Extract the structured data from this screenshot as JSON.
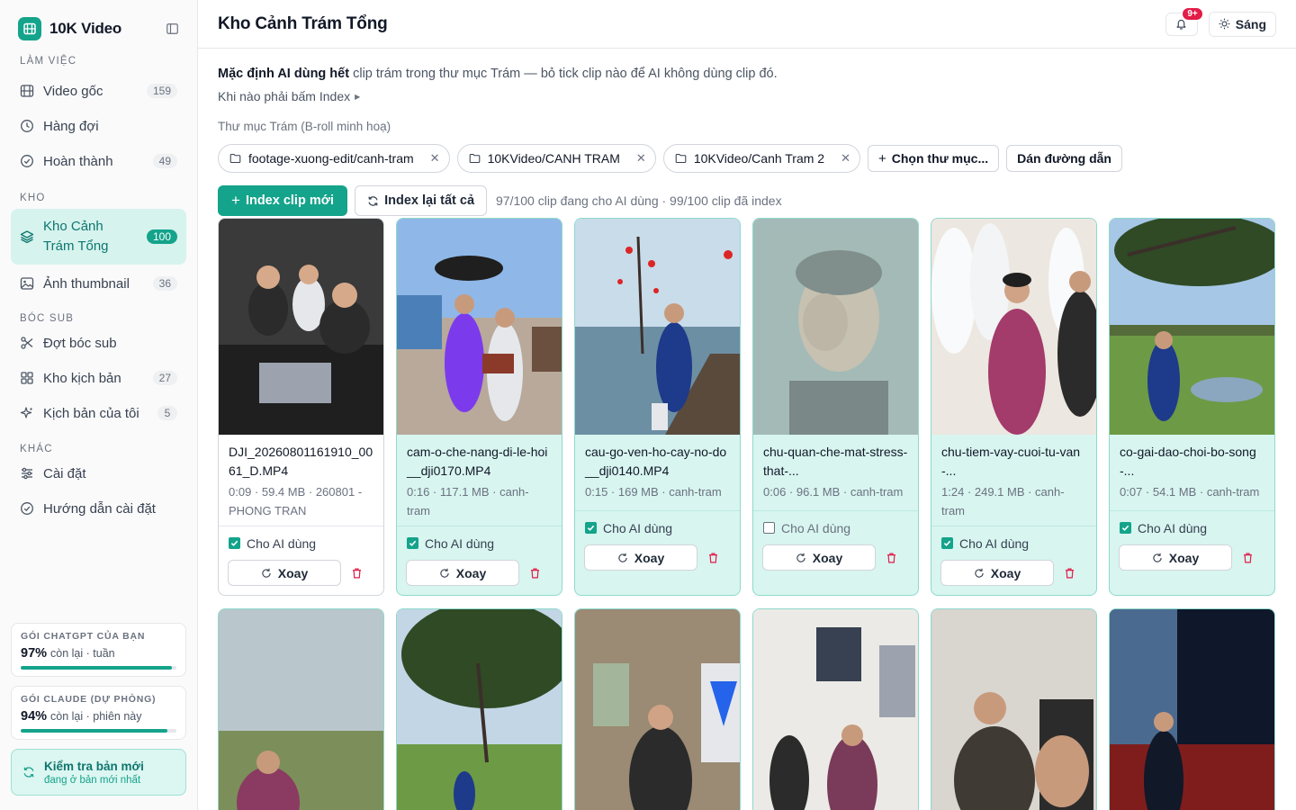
{
  "brand": {
    "name": "10K Video"
  },
  "sidebar": {
    "sections": [
      {
        "label": "LÀM VIỆC"
      },
      {
        "label": "KHO"
      },
      {
        "label": "BÓC SUB"
      },
      {
        "label": "KHÁC"
      }
    ],
    "items": [
      {
        "label": "Video gốc",
        "count": "159",
        "icon": "film-icon"
      },
      {
        "label": "Hàng đợi",
        "count": "",
        "icon": "clock-icon"
      },
      {
        "label": "Hoàn thành",
        "count": "49",
        "icon": "check-circle-icon"
      },
      {
        "label": "Kho Cảnh Trám Tổng",
        "count": "100",
        "icon": "layers-icon",
        "active": true
      },
      {
        "label": "Ảnh thumbnail",
        "count": "36",
        "icon": "image-icon"
      },
      {
        "label": "Đợt bóc sub",
        "count": "",
        "icon": "scissors-icon"
      },
      {
        "label": "Kho kịch bản",
        "count": "27",
        "icon": "grid-icon"
      },
      {
        "label": "Kịch bản của tôi",
        "count": "5",
        "icon": "sparkle-icon"
      },
      {
        "label": "Cài đặt",
        "count": "",
        "icon": "sliders-icon"
      },
      {
        "label": "Hướng dẫn cài đặt",
        "count": "",
        "icon": "check-circle-icon"
      }
    ],
    "plans": [
      {
        "title": "GÓI CHATGPT CỦA BẠN",
        "pct": "97%",
        "note": "còn lại · tuần",
        "fill": 0.97
      },
      {
        "title": "GÓI CLAUDE (DỰ PHÒNG)",
        "pct": "94%",
        "note": "còn lại · phiên này",
        "fill": 0.94
      }
    ],
    "update": {
      "title": "Kiểm tra bản mới",
      "sub": "đang ở bản mới nhất"
    }
  },
  "header": {
    "title": "Kho Cảnh Trám Tổng",
    "notif_badge": "9+",
    "theme_label": "Sáng"
  },
  "main": {
    "info_bold": "Mặc định AI dùng hết",
    "info_rest": " clip trám trong thư mục Trám — bỏ tick clip nào để AI không dùng clip đó.",
    "index_toggle": "Khi nào phải bấm Index",
    "folder_label": "Thư mục Trám (B-roll minh hoạ)",
    "folders": [
      "footage-xuong-edit/canh-tram",
      "10KVideo/CANH TRAM",
      "10KVideo/Canh Tram 2"
    ],
    "choose_folder": "Chọn thư mục...",
    "paste_path": "Dán đường dẫn",
    "index_new": "Index clip mới",
    "reindex_all": "Index lại tất cả",
    "stats": "97/100 clip đang cho AI dùng · 99/100 clip đã index",
    "check_label": "Cho AI dùng",
    "rotate_label": "Xoay"
  },
  "clips": [
    {
      "name": "DJI_20260801161910_0061_D.MP4",
      "meta": "0:09 · 59.4 MB · 260801 - PHONG TRAN",
      "checked": true,
      "selected": false
    },
    {
      "name": "cam-o-che-nang-di-le-hoi__dji0170.MP4",
      "meta": "0:16 · 117.1 MB · canh-tram",
      "checked": true,
      "selected": true
    },
    {
      "name": "cau-go-ven-ho-cay-no-do__dji0140.MP4",
      "meta": "0:15 · 169 MB · canh-tram",
      "checked": true,
      "selected": true
    },
    {
      "name": "chu-quan-che-mat-stress-that-...",
      "meta": "0:06 · 96.1 MB · canh-tram",
      "checked": false,
      "selected": true
    },
    {
      "name": "chu-tiem-vay-cuoi-tu-van-...",
      "meta": "1:24 · 249.1 MB · canh-tram",
      "checked": true,
      "selected": true
    },
    {
      "name": "co-gai-dao-choi-bo-song-...",
      "meta": "0:07 · 54.1 MB · canh-tram",
      "checked": true,
      "selected": true
    }
  ],
  "colors": {
    "accent": "#14a38b",
    "accent_light": "#d8f5f0",
    "danger": "#e11d48"
  }
}
